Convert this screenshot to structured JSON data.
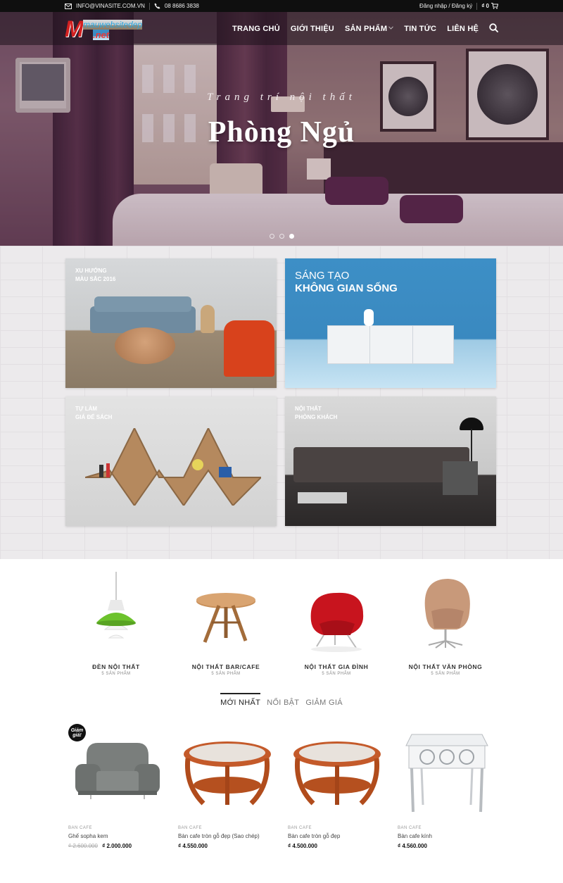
{
  "topbar": {
    "email": "INFO@VINASITE.COM.VN",
    "phone": "08 8686 3838",
    "account": "Đăng nhập / Đăng ký",
    "cart_total": "₫ 0"
  },
  "header": {
    "logo_text_1": "mauwebsitedep",
    "logo_text_2": ".net",
    "logo_letter": "M",
    "nav": [
      {
        "label": "TRANG CHỦ"
      },
      {
        "label": "GIỚI THIỆU"
      },
      {
        "label": "SẢN PHẨM"
      },
      {
        "label": "TIN TỨC"
      },
      {
        "label": "LIÊN HỆ"
      }
    ]
  },
  "hero": {
    "subtitle": "Trang trí nội thất",
    "title": "Phòng Ngủ",
    "slides": 3,
    "active_slide": 3
  },
  "banners": [
    {
      "line1": "XU HƯỚNG",
      "line2": "MÀU SẮC 2016"
    },
    {
      "line1": "SÁNG TẠO",
      "line2": "KHÔNG GIAN SỐNG"
    },
    {
      "line1": "TỰ LÀM",
      "line2": "GIÁ ĐỂ SÁCH"
    },
    {
      "line1": "NỘI THẤT",
      "line2": "PHÒNG KHÁCH"
    }
  ],
  "categories": [
    {
      "name": "ĐÈN NỘI THẤT",
      "count": "5 SẢN PHẨM"
    },
    {
      "name": "NỘI THẤT BAR/CAFE",
      "count": "5 SẢN PHẨM"
    },
    {
      "name": "NỘI THẤT GIA ĐÌNH",
      "count": "5 SẢN PHẨM"
    },
    {
      "name": "NỘI THẤT VĂN PHÒNG",
      "count": "5 SẢN PHẨM"
    }
  ],
  "tabs": [
    {
      "label": "MỚI NHẤT",
      "active": true
    },
    {
      "label": "NỔI BẬT",
      "active": false
    },
    {
      "label": "GIẢM GIÁ",
      "active": false
    }
  ],
  "products": [
    {
      "category": "BAN CAFE",
      "name": "Ghế sopha kem",
      "old_price": "₫ 2.600.000",
      "price": "₫ 2.000.000",
      "badge": "Giảm giá!"
    },
    {
      "category": "BAN CAFE",
      "name": "Bàn cafe tròn gỗ đẹp (Sao chép)",
      "price": "₫ 4.550.000"
    },
    {
      "category": "BAN CAFE",
      "name": "Bàn cafe tròn gỗ đẹp",
      "price": "₫ 4.500.000"
    },
    {
      "category": "BAN CAFE",
      "name": "Bàn cafe kính",
      "price": "₫ 4.560.000"
    }
  ],
  "colors": {
    "topbar_bg": "#0f0f0f",
    "logo_red": "#d32020",
    "logo_blue": "#29a7e0",
    "tab_active": "#222222"
  },
  "icons": [
    "envelope-icon",
    "phone-icon",
    "cart-icon",
    "search-icon",
    "chevron-down-icon"
  ]
}
